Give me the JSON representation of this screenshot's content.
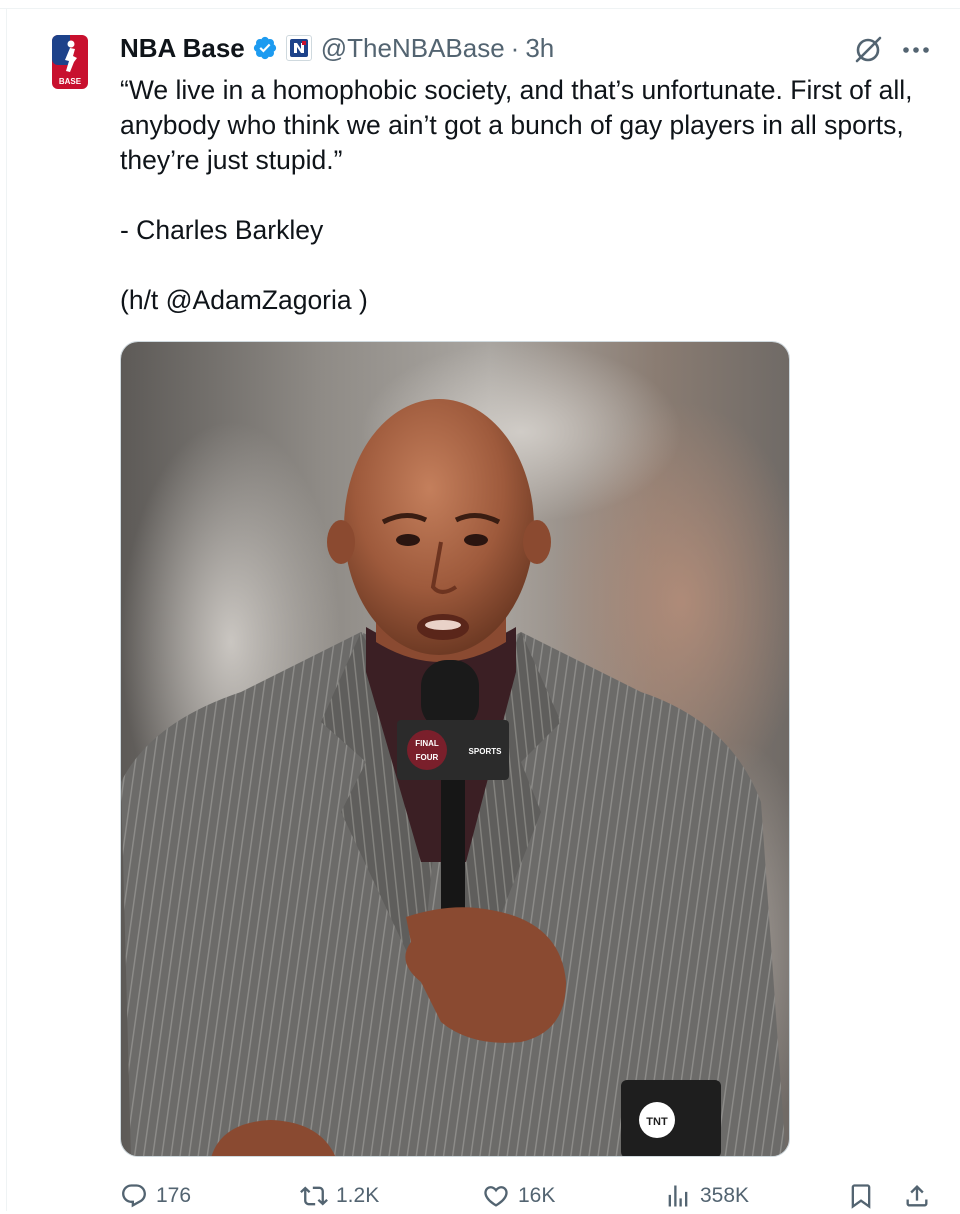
{
  "tweet": {
    "author": {
      "display_name": "NBA Base",
      "handle": "@TheNBABase",
      "time": "3h",
      "separator": "·",
      "avatar_icon": "nba-base-logo",
      "avatar_text": "BASE",
      "verified_icon": "verified-badge-icon",
      "affiliate_icon": "affiliate-badge-icon",
      "brand_color": "#c8102e",
      "accent_color": "#1d9bf0"
    },
    "text": {
      "quote": "“We live in a homophobic society, and that’s unfortunate. First of all, anybody who think we ain’t got a bunch of gay players in all sports, they’re just stupid.”",
      "attribution": "- Charles Barkley",
      "hat_tip": "(h/t @AdamZagoria )"
    },
    "media": {
      "image_icon": "photo-of-man-in-pinstripe-suit-holding-microphone",
      "mic_flag_text_1": "FINAL",
      "mic_flag_text_2": "FOUR",
      "mic_flag_text_3": "SPORTS",
      "mug_text": "TNT"
    },
    "actions": {
      "replies": "176",
      "reposts": "1.2K",
      "likes": "16K",
      "views": "358K"
    },
    "icons": {
      "grok": "grok-icon",
      "more": "more-icon",
      "reply": "reply-icon",
      "repost": "repost-icon",
      "like": "heart-icon",
      "views": "views-icon",
      "bookmark": "bookmark-icon",
      "share": "share-icon"
    },
    "colors": {
      "text_primary": "#0f1419",
      "text_secondary": "#536471",
      "border": "#cfd9de"
    }
  }
}
